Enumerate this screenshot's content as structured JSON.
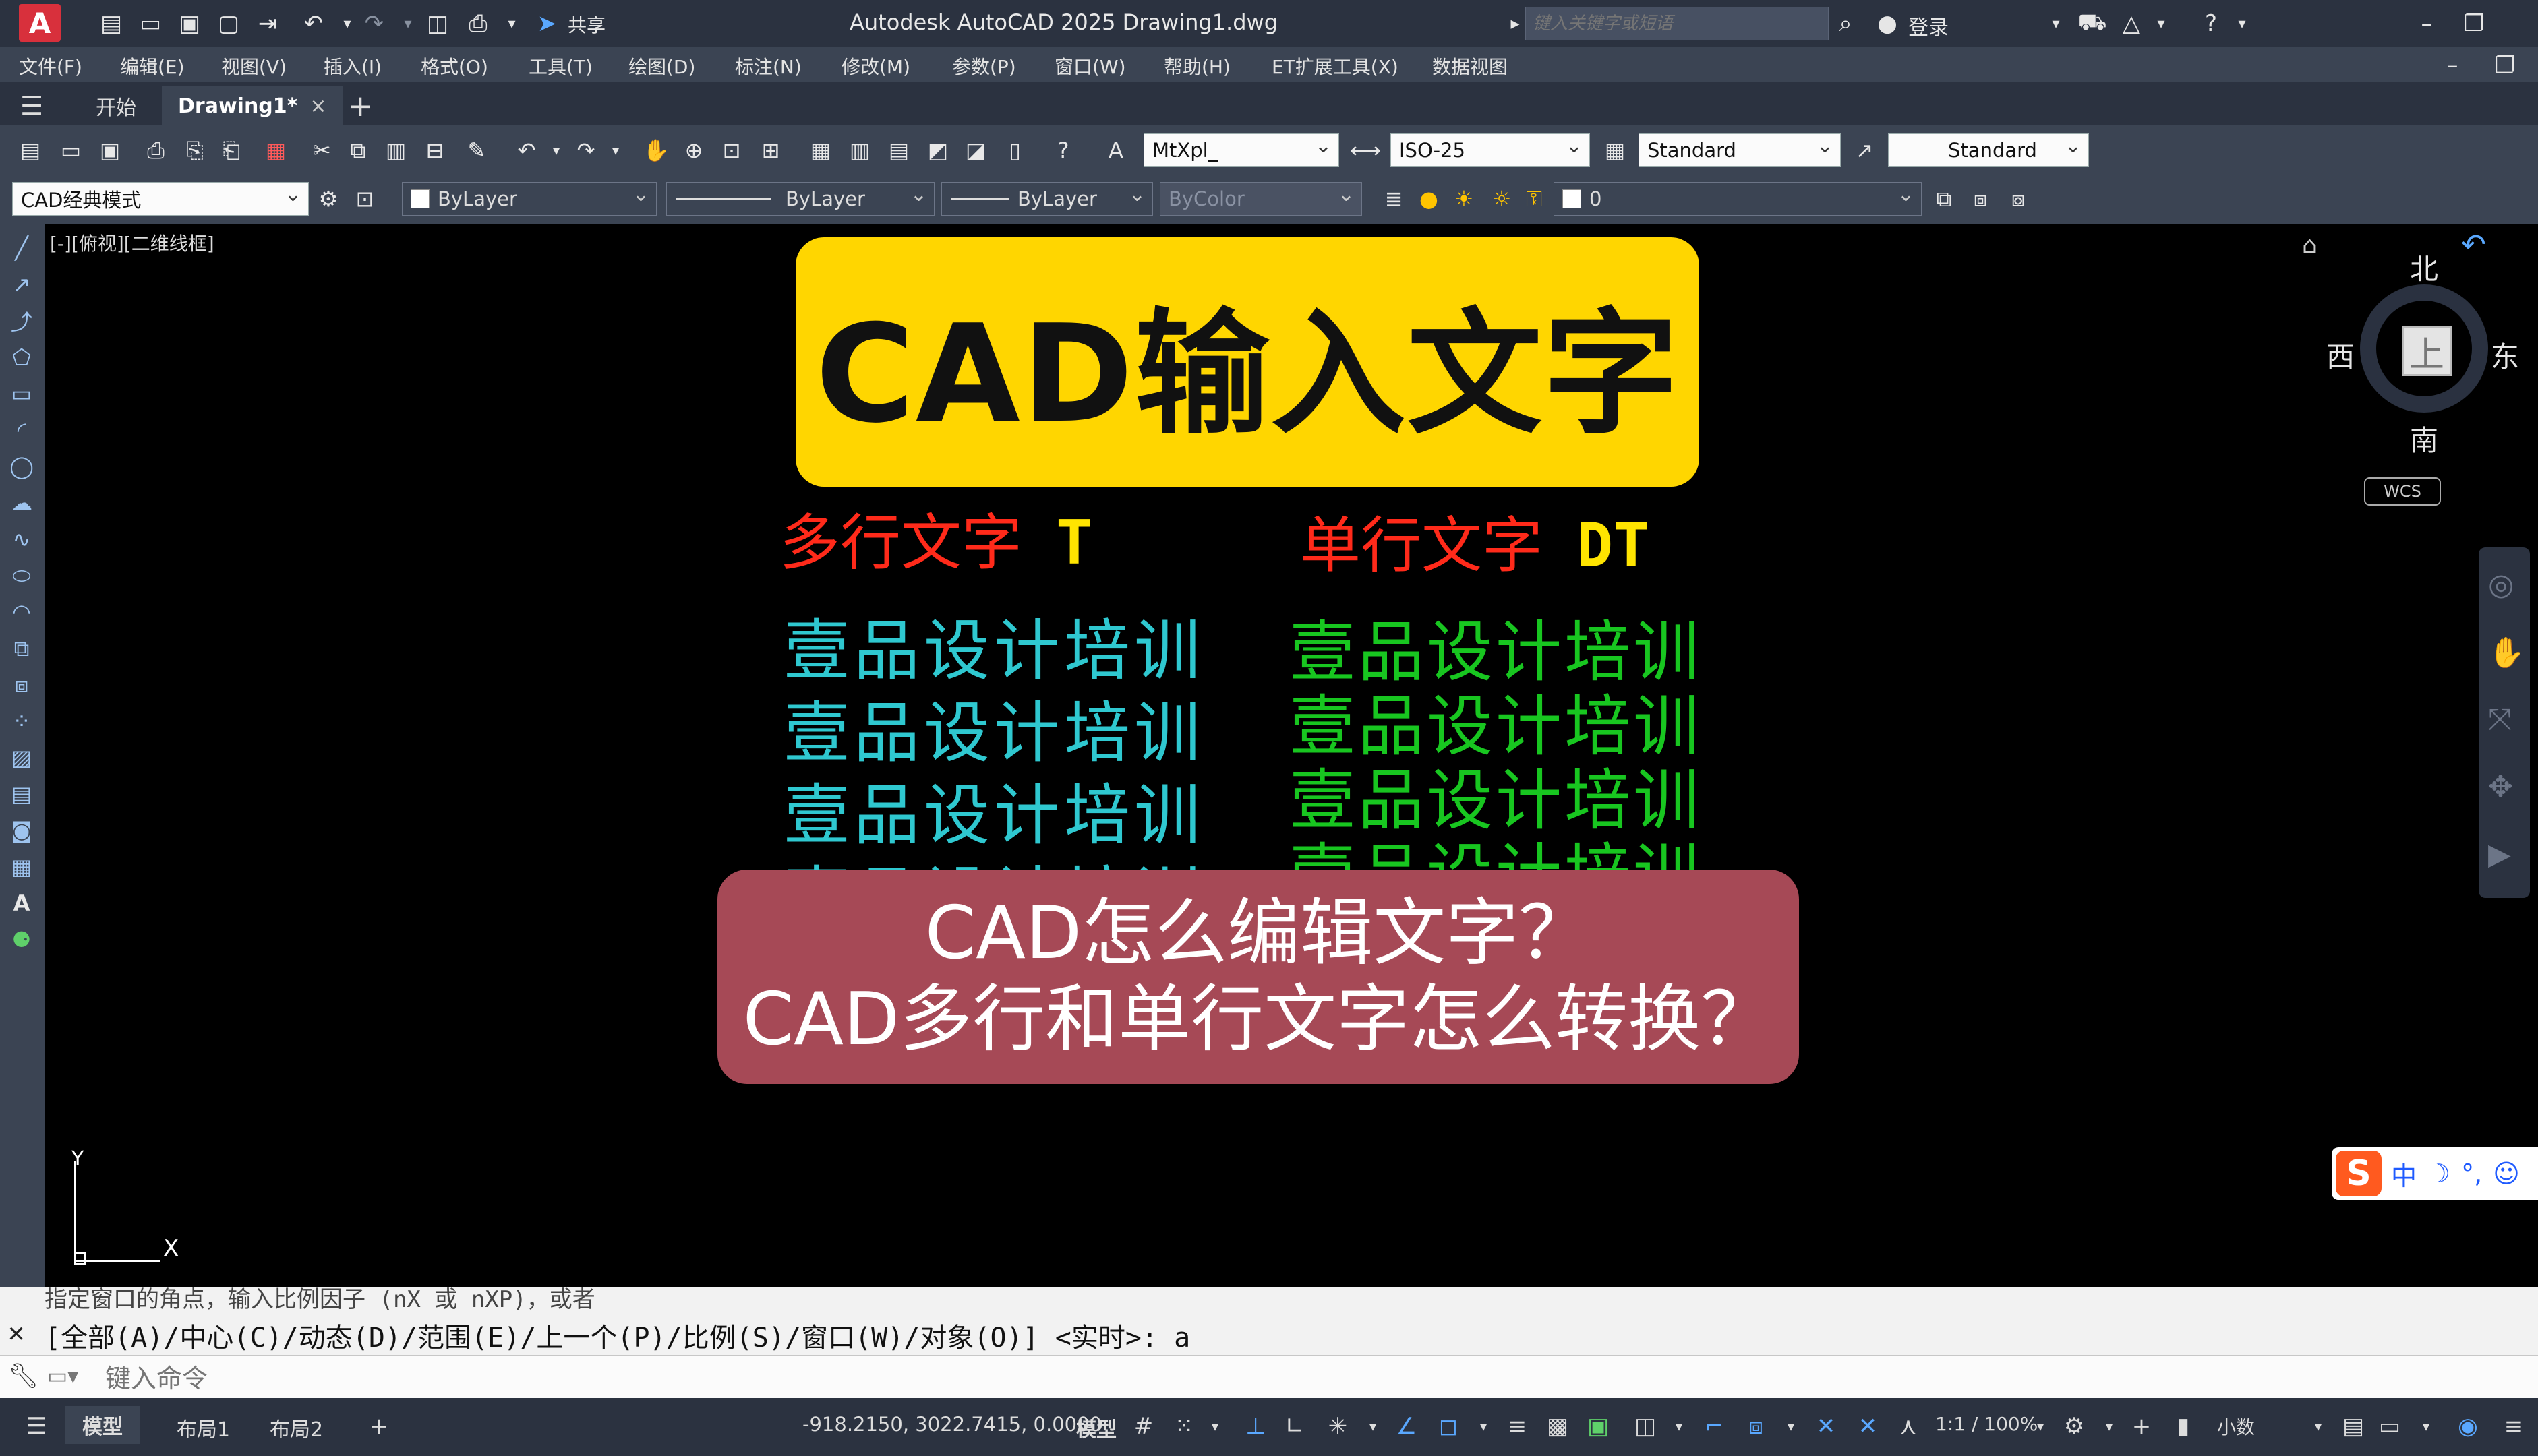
{
  "titlebar": {
    "app_logo": "A",
    "share_label": "共享",
    "title": "Autodesk AutoCAD 2025    Drawing1.dwg",
    "search_placeholder": "键入关键字或短语",
    "login_label": "登录"
  },
  "menu": [
    "文件(F)",
    "编辑(E)",
    "视图(V)",
    "插入(I)",
    "格式(O)",
    "工具(T)",
    "绘图(D)",
    "标注(N)",
    "修改(M)",
    "参数(P)",
    "窗口(W)",
    "帮助(H)",
    "ET扩展工具(X)",
    "数据视图"
  ],
  "tabs": {
    "start": "开始",
    "drawing": "Drawing1*",
    "close": "×",
    "add": "+"
  },
  "toolbar1": {
    "text_style": "MtXpl_",
    "dim_style": "ISO-25",
    "table_style": "Standard",
    "multileader_style": "Standard"
  },
  "toolbar2": {
    "workspace": "CAD经典模式",
    "color": "ByLayer",
    "linetype": "ByLayer",
    "lineweight": "ByLayer",
    "plotstyle": "ByColor",
    "layer": "0"
  },
  "canvas": {
    "view_label": "[-][俯视][二维线框]",
    "banner": "CAD输入文字",
    "mtext_header": "多行文字",
    "mtext_cmd": "T",
    "dtext_header": "单行文字",
    "dtext_cmd": "DT",
    "sample": "壹品设计培训",
    "question1": "CAD怎么编辑文字？",
    "question2": "CAD多行和单行文字怎么转换？",
    "ucs_y": "Y",
    "ucs_x": "X"
  },
  "navcube": {
    "top": "上",
    "north": "北",
    "south": "南",
    "east": "东",
    "west": "西",
    "wcs": "WCS"
  },
  "ime": {
    "logo": "S",
    "mode": "中"
  },
  "command": {
    "history1": "指定窗口的角点，输入比例因子 (nX 或 nXP)，或者",
    "history2": "[全部(A)/中心(C)/动态(D)/范围(E)/上一个(P)/比例(S)/窗口(W)/对象(O)] <实时>: a",
    "input_placeholder": "键入命令"
  },
  "status": {
    "model_tab": "模型",
    "layout1": "布局1",
    "layout2": "布局2",
    "coords": "-918.2150, 3022.7415, 0.0000",
    "model_label": "模型",
    "scale": "1:1 / 100%",
    "units": "小数"
  },
  "colors": {
    "banner_bg": "#ffd600",
    "mtext_header": "#ff2a1a",
    "dtext_header": "#ff2a1a",
    "cyan_text": "#2fc8d0",
    "green_text": "#18c620",
    "rose_box": "#a64956",
    "canvas": "#000000"
  }
}
